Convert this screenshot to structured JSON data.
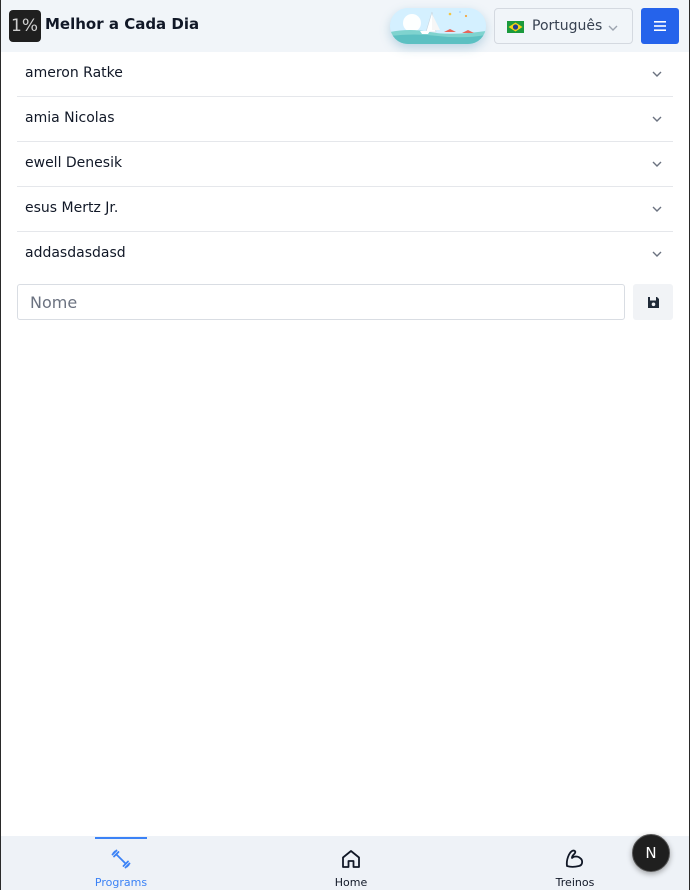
{
  "header": {
    "logo_text": "1%",
    "title": "Melhor a Cada Dia",
    "language": {
      "selected": "Português",
      "flag": "brazil-flag-icon"
    },
    "menu_icon": "hamburger-menu-icon"
  },
  "programs": {
    "items": [
      {
        "label": "ameron Ratke"
      },
      {
        "label": "amia Nicolas"
      },
      {
        "label": "ewell Denesik"
      },
      {
        "label": "esus Mertz Jr."
      },
      {
        "label": "addasdasdasd"
      }
    ],
    "name_input": {
      "value": "",
      "placeholder": "Nome"
    },
    "save_icon": "floppy-disk-icon"
  },
  "bottom_nav": {
    "items": [
      {
        "label": "Programs",
        "icon": "dumbbell-icon",
        "active": true
      },
      {
        "label": "Home",
        "icon": "home-icon",
        "active": false
      },
      {
        "label": "Treinos",
        "icon": "flexed-bicep-icon",
        "active": false
      }
    ]
  },
  "next_badge": "N",
  "colors": {
    "accent": "#2563eb",
    "active_nav": "#3b82f6",
    "header_bg": "#f1f5f9",
    "nav_bg": "#eef2f7"
  }
}
